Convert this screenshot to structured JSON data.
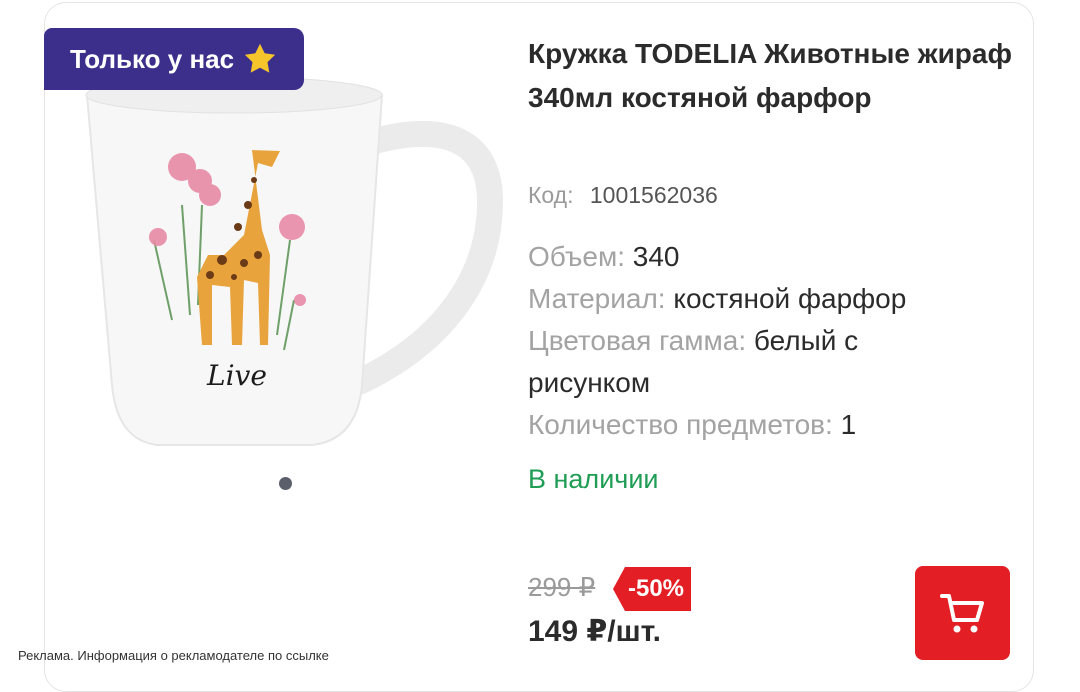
{
  "badge": {
    "label": "Только у нас",
    "icon": "star-icon",
    "color": "#3c2f8c",
    "star_color": "#f6c52b"
  },
  "product": {
    "title": "Кружка TODELIA Животные жираф 340мл костяной фарфор",
    "image_text": "Live",
    "code_label": "Код:",
    "code_value": "1001562036",
    "specs": [
      {
        "label": "Объем:",
        "value": "340"
      },
      {
        "label": "Материал:",
        "value": "костяной фарфор"
      },
      {
        "label": "Цветовая гамма:",
        "value": "белый с рисунком"
      },
      {
        "label": "Количество предметов:",
        "value": "1"
      }
    ],
    "availability": "В наличии",
    "old_price": "299 ₽",
    "discount": "-50%",
    "price": "149 ₽/шт."
  },
  "carousel": {
    "slide_count": 1,
    "active_index": 0
  },
  "cart_button": {
    "icon": "cart-icon",
    "color": "#e31e24"
  },
  "ad_note": "Реклама. Информация о рекламодателе по ссылке",
  "colors": {
    "accent_red": "#e31e24",
    "in_stock_green": "#1f9d55"
  }
}
